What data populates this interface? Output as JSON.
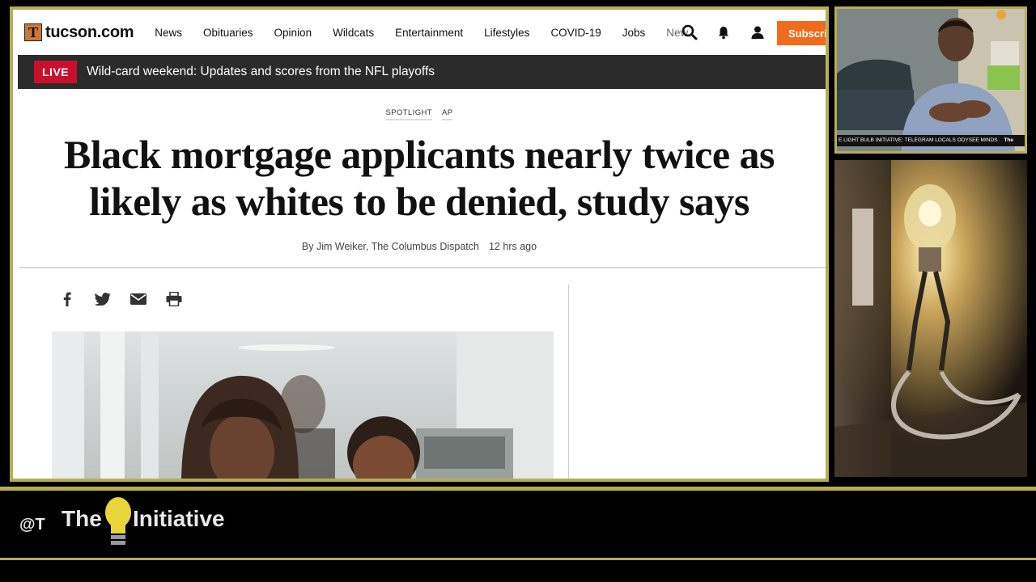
{
  "site": {
    "logo_letter": "T",
    "logo_text": "tucson.com",
    "nav": [
      "News",
      "Obituaries",
      "Opinion",
      "Wildcats",
      "Entertainment",
      "Lifestyles",
      "COVID-19",
      "Jobs",
      "News"
    ],
    "subscribe_label": "Subscri"
  },
  "live": {
    "badge": "LIVE",
    "text": "Wild-card weekend: Updates and scores from the NFL playoffs"
  },
  "article": {
    "tags": [
      "SPOTLIGHT",
      "AP"
    ],
    "headline_line1": "Black mortgage applicants nearly twice as",
    "headline_line2": "likely as whites to be denied, study says",
    "byline": "By Jim Weiker, The Columbus Dispatch",
    "time": "12 hrs ago"
  },
  "video": {
    "ticker": "E LIGHT BULB INITIATIVE: TELEGRAM LOCALS ODYSEE MINDS",
    "ticker_brand": "The"
  },
  "banner": {
    "handle": "@T",
    "brand_the": "The",
    "brand_initiative": "Initiative"
  },
  "colors": {
    "frame_gold": "#b6ad57",
    "subscribe_orange": "#f26b1d",
    "live_red": "#c8102e",
    "bulb_yellow": "#e8d53a"
  }
}
